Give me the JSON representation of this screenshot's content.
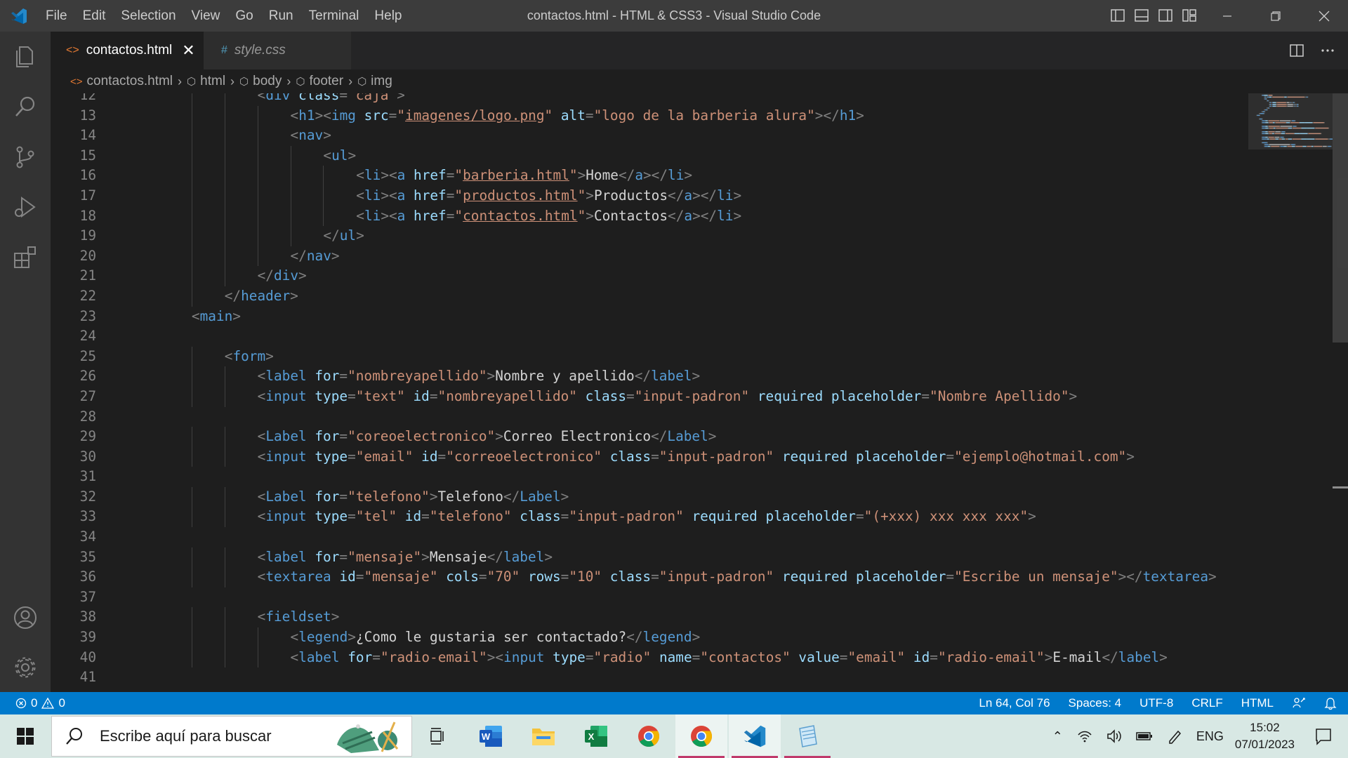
{
  "window": {
    "title": "contactos.html - HTML & CSS3 - Visual Studio Code",
    "menu": [
      "File",
      "Edit",
      "Selection",
      "View",
      "Go",
      "Run",
      "Terminal",
      "Help"
    ]
  },
  "tabs": [
    {
      "label": "contactos.html",
      "icon": "<>",
      "active": true
    },
    {
      "label": "style.css",
      "icon": "#",
      "active": false
    }
  ],
  "breadcrumb": [
    "contactos.html",
    "html",
    "body",
    "footer",
    "img"
  ],
  "editor": {
    "lines": [
      {
        "n": "12",
        "indent": 3,
        "tokens": [
          [
            "p",
            "<"
          ],
          [
            "t",
            "div"
          ],
          [
            "a",
            " class"
          ],
          [
            "p",
            "="
          ],
          [
            "s",
            "\"caja\""
          ],
          [
            "p",
            ">"
          ]
        ]
      },
      {
        "n": "13",
        "indent": 4,
        "tokens": [
          [
            "p",
            "<"
          ],
          [
            "t",
            "h1"
          ],
          [
            "p",
            "><"
          ],
          [
            "t",
            "img"
          ],
          [
            "a",
            " src"
          ],
          [
            "p",
            "="
          ],
          [
            "s",
            "\""
          ],
          [
            "l",
            "imagenes/logo.png"
          ],
          [
            "s",
            "\""
          ],
          [
            "a",
            " alt"
          ],
          [
            "p",
            "="
          ],
          [
            "s",
            "\"logo de la barberia alura\""
          ],
          [
            "p",
            "></"
          ],
          [
            "t",
            "h1"
          ],
          [
            "p",
            ">"
          ]
        ]
      },
      {
        "n": "14",
        "indent": 4,
        "tokens": [
          [
            "p",
            "<"
          ],
          [
            "t",
            "nav"
          ],
          [
            "p",
            ">"
          ]
        ]
      },
      {
        "n": "15",
        "indent": 5,
        "tokens": [
          [
            "p",
            "<"
          ],
          [
            "t",
            "ul"
          ],
          [
            "p",
            ">"
          ]
        ]
      },
      {
        "n": "16",
        "indent": 6,
        "tokens": [
          [
            "p",
            "<"
          ],
          [
            "t",
            "li"
          ],
          [
            "p",
            "><"
          ],
          [
            "t",
            "a"
          ],
          [
            "a",
            " href"
          ],
          [
            "p",
            "="
          ],
          [
            "s",
            "\""
          ],
          [
            "l",
            "barberia.html"
          ],
          [
            "s",
            "\""
          ],
          [
            "p",
            ">"
          ],
          [
            "x",
            "Home"
          ],
          [
            "p",
            "</"
          ],
          [
            "t",
            "a"
          ],
          [
            "p",
            "></"
          ],
          [
            "t",
            "li"
          ],
          [
            "p",
            ">"
          ]
        ]
      },
      {
        "n": "17",
        "indent": 6,
        "tokens": [
          [
            "p",
            "<"
          ],
          [
            "t",
            "li"
          ],
          [
            "p",
            "><"
          ],
          [
            "t",
            "a"
          ],
          [
            "a",
            " href"
          ],
          [
            "p",
            "="
          ],
          [
            "s",
            "\""
          ],
          [
            "l",
            "productos.html"
          ],
          [
            "s",
            "\""
          ],
          [
            "p",
            ">"
          ],
          [
            "x",
            "Productos"
          ],
          [
            "p",
            "</"
          ],
          [
            "t",
            "a"
          ],
          [
            "p",
            "></"
          ],
          [
            "t",
            "li"
          ],
          [
            "p",
            ">"
          ]
        ]
      },
      {
        "n": "18",
        "indent": 6,
        "tokens": [
          [
            "p",
            "<"
          ],
          [
            "t",
            "li"
          ],
          [
            "p",
            "><"
          ],
          [
            "t",
            "a"
          ],
          [
            "a",
            " href"
          ],
          [
            "p",
            "="
          ],
          [
            "s",
            "\""
          ],
          [
            "l",
            "contactos.html"
          ],
          [
            "s",
            "\""
          ],
          [
            "p",
            ">"
          ],
          [
            "x",
            "Contactos"
          ],
          [
            "p",
            "</"
          ],
          [
            "t",
            "a"
          ],
          [
            "p",
            "></"
          ],
          [
            "t",
            "li"
          ],
          [
            "p",
            ">"
          ]
        ]
      },
      {
        "n": "19",
        "indent": 5,
        "tokens": [
          [
            "p",
            "</"
          ],
          [
            "t",
            "ul"
          ],
          [
            "p",
            ">"
          ]
        ]
      },
      {
        "n": "20",
        "indent": 4,
        "tokens": [
          [
            "p",
            "</"
          ],
          [
            "t",
            "nav"
          ],
          [
            "p",
            ">"
          ]
        ]
      },
      {
        "n": "21",
        "indent": 3,
        "tokens": [
          [
            "p",
            "</"
          ],
          [
            "t",
            "div"
          ],
          [
            "p",
            ">"
          ]
        ]
      },
      {
        "n": "22",
        "indent": 2,
        "tokens": [
          [
            "p",
            "</"
          ],
          [
            "t",
            "header"
          ],
          [
            "p",
            ">"
          ]
        ]
      },
      {
        "n": "23",
        "indent": 1,
        "tokens": [
          [
            "p",
            "<"
          ],
          [
            "t",
            "main"
          ],
          [
            "p",
            ">"
          ]
        ]
      },
      {
        "n": "24",
        "indent": 0,
        "tokens": []
      },
      {
        "n": "25",
        "indent": 2,
        "tokens": [
          [
            "p",
            "<"
          ],
          [
            "t",
            "form"
          ],
          [
            "p",
            ">"
          ]
        ]
      },
      {
        "n": "26",
        "indent": 3,
        "tokens": [
          [
            "p",
            "<"
          ],
          [
            "t",
            "label"
          ],
          [
            "a",
            " for"
          ],
          [
            "p",
            "="
          ],
          [
            "s",
            "\"nombreyapellido\""
          ],
          [
            "p",
            ">"
          ],
          [
            "x",
            "Nombre y apellido"
          ],
          [
            "p",
            "</"
          ],
          [
            "t",
            "label"
          ],
          [
            "p",
            ">"
          ]
        ]
      },
      {
        "n": "27",
        "indent": 3,
        "tokens": [
          [
            "p",
            "<"
          ],
          [
            "t",
            "input"
          ],
          [
            "a",
            " type"
          ],
          [
            "p",
            "="
          ],
          [
            "s",
            "\"text\""
          ],
          [
            "a",
            " id"
          ],
          [
            "p",
            "="
          ],
          [
            "s",
            "\"nombreyapellido\""
          ],
          [
            "a",
            " class"
          ],
          [
            "p",
            "="
          ],
          [
            "s",
            "\"input-padron\""
          ],
          [
            "a",
            " required"
          ],
          [
            "a",
            " placeholder"
          ],
          [
            "p",
            "="
          ],
          [
            "s",
            "\"Nombre Apellido\""
          ],
          [
            "p",
            ">"
          ]
        ]
      },
      {
        "n": "28",
        "indent": 0,
        "tokens": []
      },
      {
        "n": "29",
        "indent": 3,
        "tokens": [
          [
            "p",
            "<"
          ],
          [
            "t",
            "Label"
          ],
          [
            "a",
            " for"
          ],
          [
            "p",
            "="
          ],
          [
            "s",
            "\"coreoelectronico\""
          ],
          [
            "p",
            ">"
          ],
          [
            "x",
            "Correo Electronico"
          ],
          [
            "p",
            "</"
          ],
          [
            "t",
            "Label"
          ],
          [
            "p",
            ">"
          ]
        ]
      },
      {
        "n": "30",
        "indent": 3,
        "tokens": [
          [
            "p",
            "<"
          ],
          [
            "t",
            "input"
          ],
          [
            "a",
            " type"
          ],
          [
            "p",
            "="
          ],
          [
            "s",
            "\"email\""
          ],
          [
            "a",
            " id"
          ],
          [
            "p",
            "="
          ],
          [
            "s",
            "\"correoelectronico\""
          ],
          [
            "a",
            " class"
          ],
          [
            "p",
            "="
          ],
          [
            "s",
            "\"input-padron\""
          ],
          [
            "a",
            " required"
          ],
          [
            "a",
            " placeholder"
          ],
          [
            "p",
            "="
          ],
          [
            "s",
            "\"ejemplo@hotmail.com\""
          ],
          [
            "p",
            ">"
          ]
        ]
      },
      {
        "n": "31",
        "indent": 0,
        "tokens": []
      },
      {
        "n": "32",
        "indent": 3,
        "tokens": [
          [
            "p",
            "<"
          ],
          [
            "t",
            "Label"
          ],
          [
            "a",
            " for"
          ],
          [
            "p",
            "="
          ],
          [
            "s",
            "\"telefono\""
          ],
          [
            "p",
            ">"
          ],
          [
            "x",
            "Telefono"
          ],
          [
            "p",
            "</"
          ],
          [
            "t",
            "Label"
          ],
          [
            "p",
            ">"
          ]
        ]
      },
      {
        "n": "33",
        "indent": 3,
        "tokens": [
          [
            "p",
            "<"
          ],
          [
            "t",
            "input"
          ],
          [
            "a",
            " type"
          ],
          [
            "p",
            "="
          ],
          [
            "s",
            "\"tel\""
          ],
          [
            "a",
            " id"
          ],
          [
            "p",
            "="
          ],
          [
            "s",
            "\"telefono\""
          ],
          [
            "a",
            " class"
          ],
          [
            "p",
            "="
          ],
          [
            "s",
            "\"input-padron\""
          ],
          [
            "a",
            " required"
          ],
          [
            "a",
            " placeholder"
          ],
          [
            "p",
            "="
          ],
          [
            "s",
            "\"(+xxx) xxx xxx xxx\""
          ],
          [
            "p",
            ">"
          ]
        ]
      },
      {
        "n": "34",
        "indent": 0,
        "tokens": []
      },
      {
        "n": "35",
        "indent": 3,
        "tokens": [
          [
            "p",
            "<"
          ],
          [
            "t",
            "label"
          ],
          [
            "a",
            " for"
          ],
          [
            "p",
            "="
          ],
          [
            "s",
            "\"mensaje\""
          ],
          [
            "p",
            ">"
          ],
          [
            "x",
            "Mensaje"
          ],
          [
            "p",
            "</"
          ],
          [
            "t",
            "label"
          ],
          [
            "p",
            ">"
          ]
        ]
      },
      {
        "n": "36",
        "indent": 3,
        "tokens": [
          [
            "p",
            "<"
          ],
          [
            "t",
            "textarea"
          ],
          [
            "a",
            " id"
          ],
          [
            "p",
            "="
          ],
          [
            "s",
            "\"mensaje\""
          ],
          [
            "a",
            " cols"
          ],
          [
            "p",
            "="
          ],
          [
            "s",
            "\"70\""
          ],
          [
            "a",
            " rows"
          ],
          [
            "p",
            "="
          ],
          [
            "s",
            "\"10\""
          ],
          [
            "a",
            " class"
          ],
          [
            "p",
            "="
          ],
          [
            "s",
            "\"input-padron\""
          ],
          [
            "a",
            " required"
          ],
          [
            "a",
            " placeholder"
          ],
          [
            "p",
            "="
          ],
          [
            "s",
            "\"Escribe un mensaje\""
          ],
          [
            "p",
            "></"
          ],
          [
            "t",
            "textarea"
          ],
          [
            "p",
            ">"
          ]
        ]
      },
      {
        "n": "37",
        "indent": 0,
        "tokens": []
      },
      {
        "n": "38",
        "indent": 3,
        "tokens": [
          [
            "p",
            "<"
          ],
          [
            "t",
            "fieldset"
          ],
          [
            "p",
            ">"
          ]
        ]
      },
      {
        "n": "39",
        "indent": 4,
        "tokens": [
          [
            "p",
            "<"
          ],
          [
            "t",
            "legend"
          ],
          [
            "p",
            ">"
          ],
          [
            "x",
            "¿Como le gustaria ser contactado?"
          ],
          [
            "p",
            "</"
          ],
          [
            "t",
            "legend"
          ],
          [
            "p",
            ">"
          ]
        ]
      },
      {
        "n": "40",
        "indent": 4,
        "tokens": [
          [
            "p",
            "<"
          ],
          [
            "t",
            "label"
          ],
          [
            "a",
            " for"
          ],
          [
            "p",
            "="
          ],
          [
            "s",
            "\"radio-email\""
          ],
          [
            "p",
            "><"
          ],
          [
            "t",
            "input"
          ],
          [
            "a",
            " type"
          ],
          [
            "p",
            "="
          ],
          [
            "s",
            "\"radio\""
          ],
          [
            "a",
            " name"
          ],
          [
            "p",
            "="
          ],
          [
            "s",
            "\"contactos\""
          ],
          [
            "a",
            " value"
          ],
          [
            "p",
            "="
          ],
          [
            "s",
            "\"email\""
          ],
          [
            "a",
            " id"
          ],
          [
            "p",
            "="
          ],
          [
            "s",
            "\"radio-email\""
          ],
          [
            "p",
            ">"
          ],
          [
            "x",
            "E-mail"
          ],
          [
            "p",
            "</"
          ],
          [
            "t",
            "label"
          ],
          [
            "p",
            ">"
          ]
        ]
      },
      {
        "n": "41",
        "indent": 0,
        "tokens": []
      }
    ]
  },
  "statusbar": {
    "errors": "0",
    "warnings": "0",
    "position": "Ln 64, Col 76",
    "spaces": "Spaces: 4",
    "encoding": "UTF-8",
    "eol": "CRLF",
    "language": "HTML"
  },
  "taskbar": {
    "search_placeholder": "Escribe aquí para buscar",
    "language": "ENG",
    "time": "15:02",
    "date": "07/01/2023"
  },
  "colors": {
    "status_bar": "#007acc",
    "tag": "#569cd6",
    "attribute": "#9cdcfe",
    "string": "#ce9178",
    "text": "#d4d4d4"
  }
}
